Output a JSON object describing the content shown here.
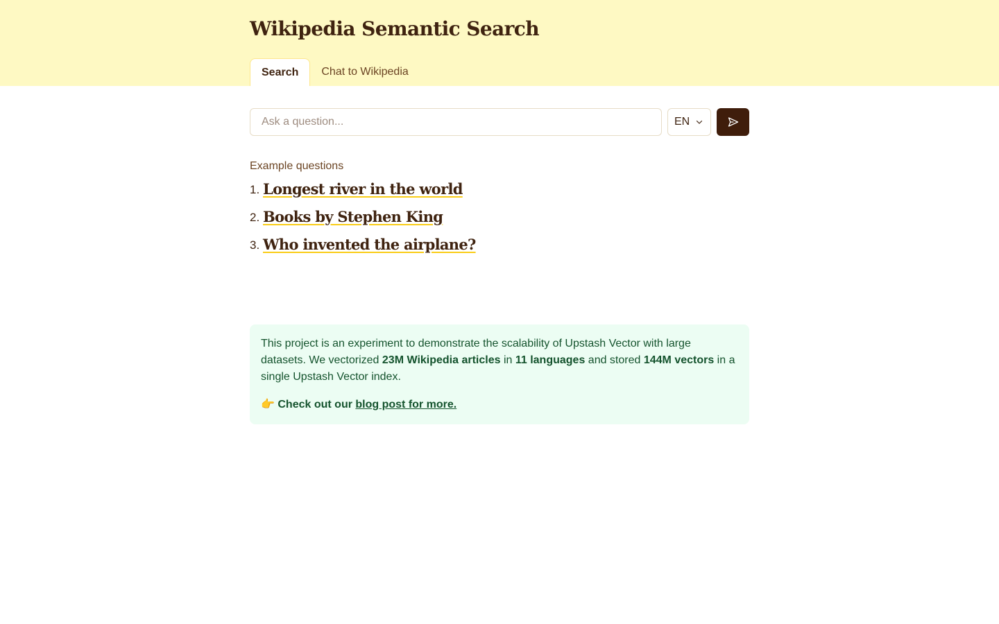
{
  "header": {
    "title": "Wikipedia Semantic Search",
    "tabs": [
      {
        "label": "Search",
        "active": true
      },
      {
        "label": "Chat to Wikipedia",
        "active": false
      }
    ]
  },
  "search": {
    "placeholder": "Ask a question...",
    "value": "",
    "language": "EN",
    "send_icon": "send-icon"
  },
  "examples": {
    "label": "Example questions",
    "items": [
      {
        "number": "1.",
        "text": "Longest river in the world"
      },
      {
        "number": "2.",
        "text": "Books by Stephen King"
      },
      {
        "number": "3.",
        "text": "Who invented the airplane?"
      }
    ]
  },
  "info": {
    "intro": "This project is an experiment to demonstrate the scalability of Upstash Vector with large datasets. We vectorized ",
    "articles": "23M Wikipedia articles",
    "in_text": " in ",
    "languages": "11 languages",
    "stored_text": " and stored ",
    "vectors": "144M vectors",
    "outro": " in a single Upstash Vector index.",
    "cta_emoji": "👉",
    "cta_text": "Check out our ",
    "cta_link": "blog post for more."
  },
  "colors": {
    "header_bg": "#fef9c3",
    "brand_dark": "#3f1d0b",
    "link_underline": "#facc15",
    "info_bg": "#ecfdf3",
    "info_text": "#14532d"
  }
}
